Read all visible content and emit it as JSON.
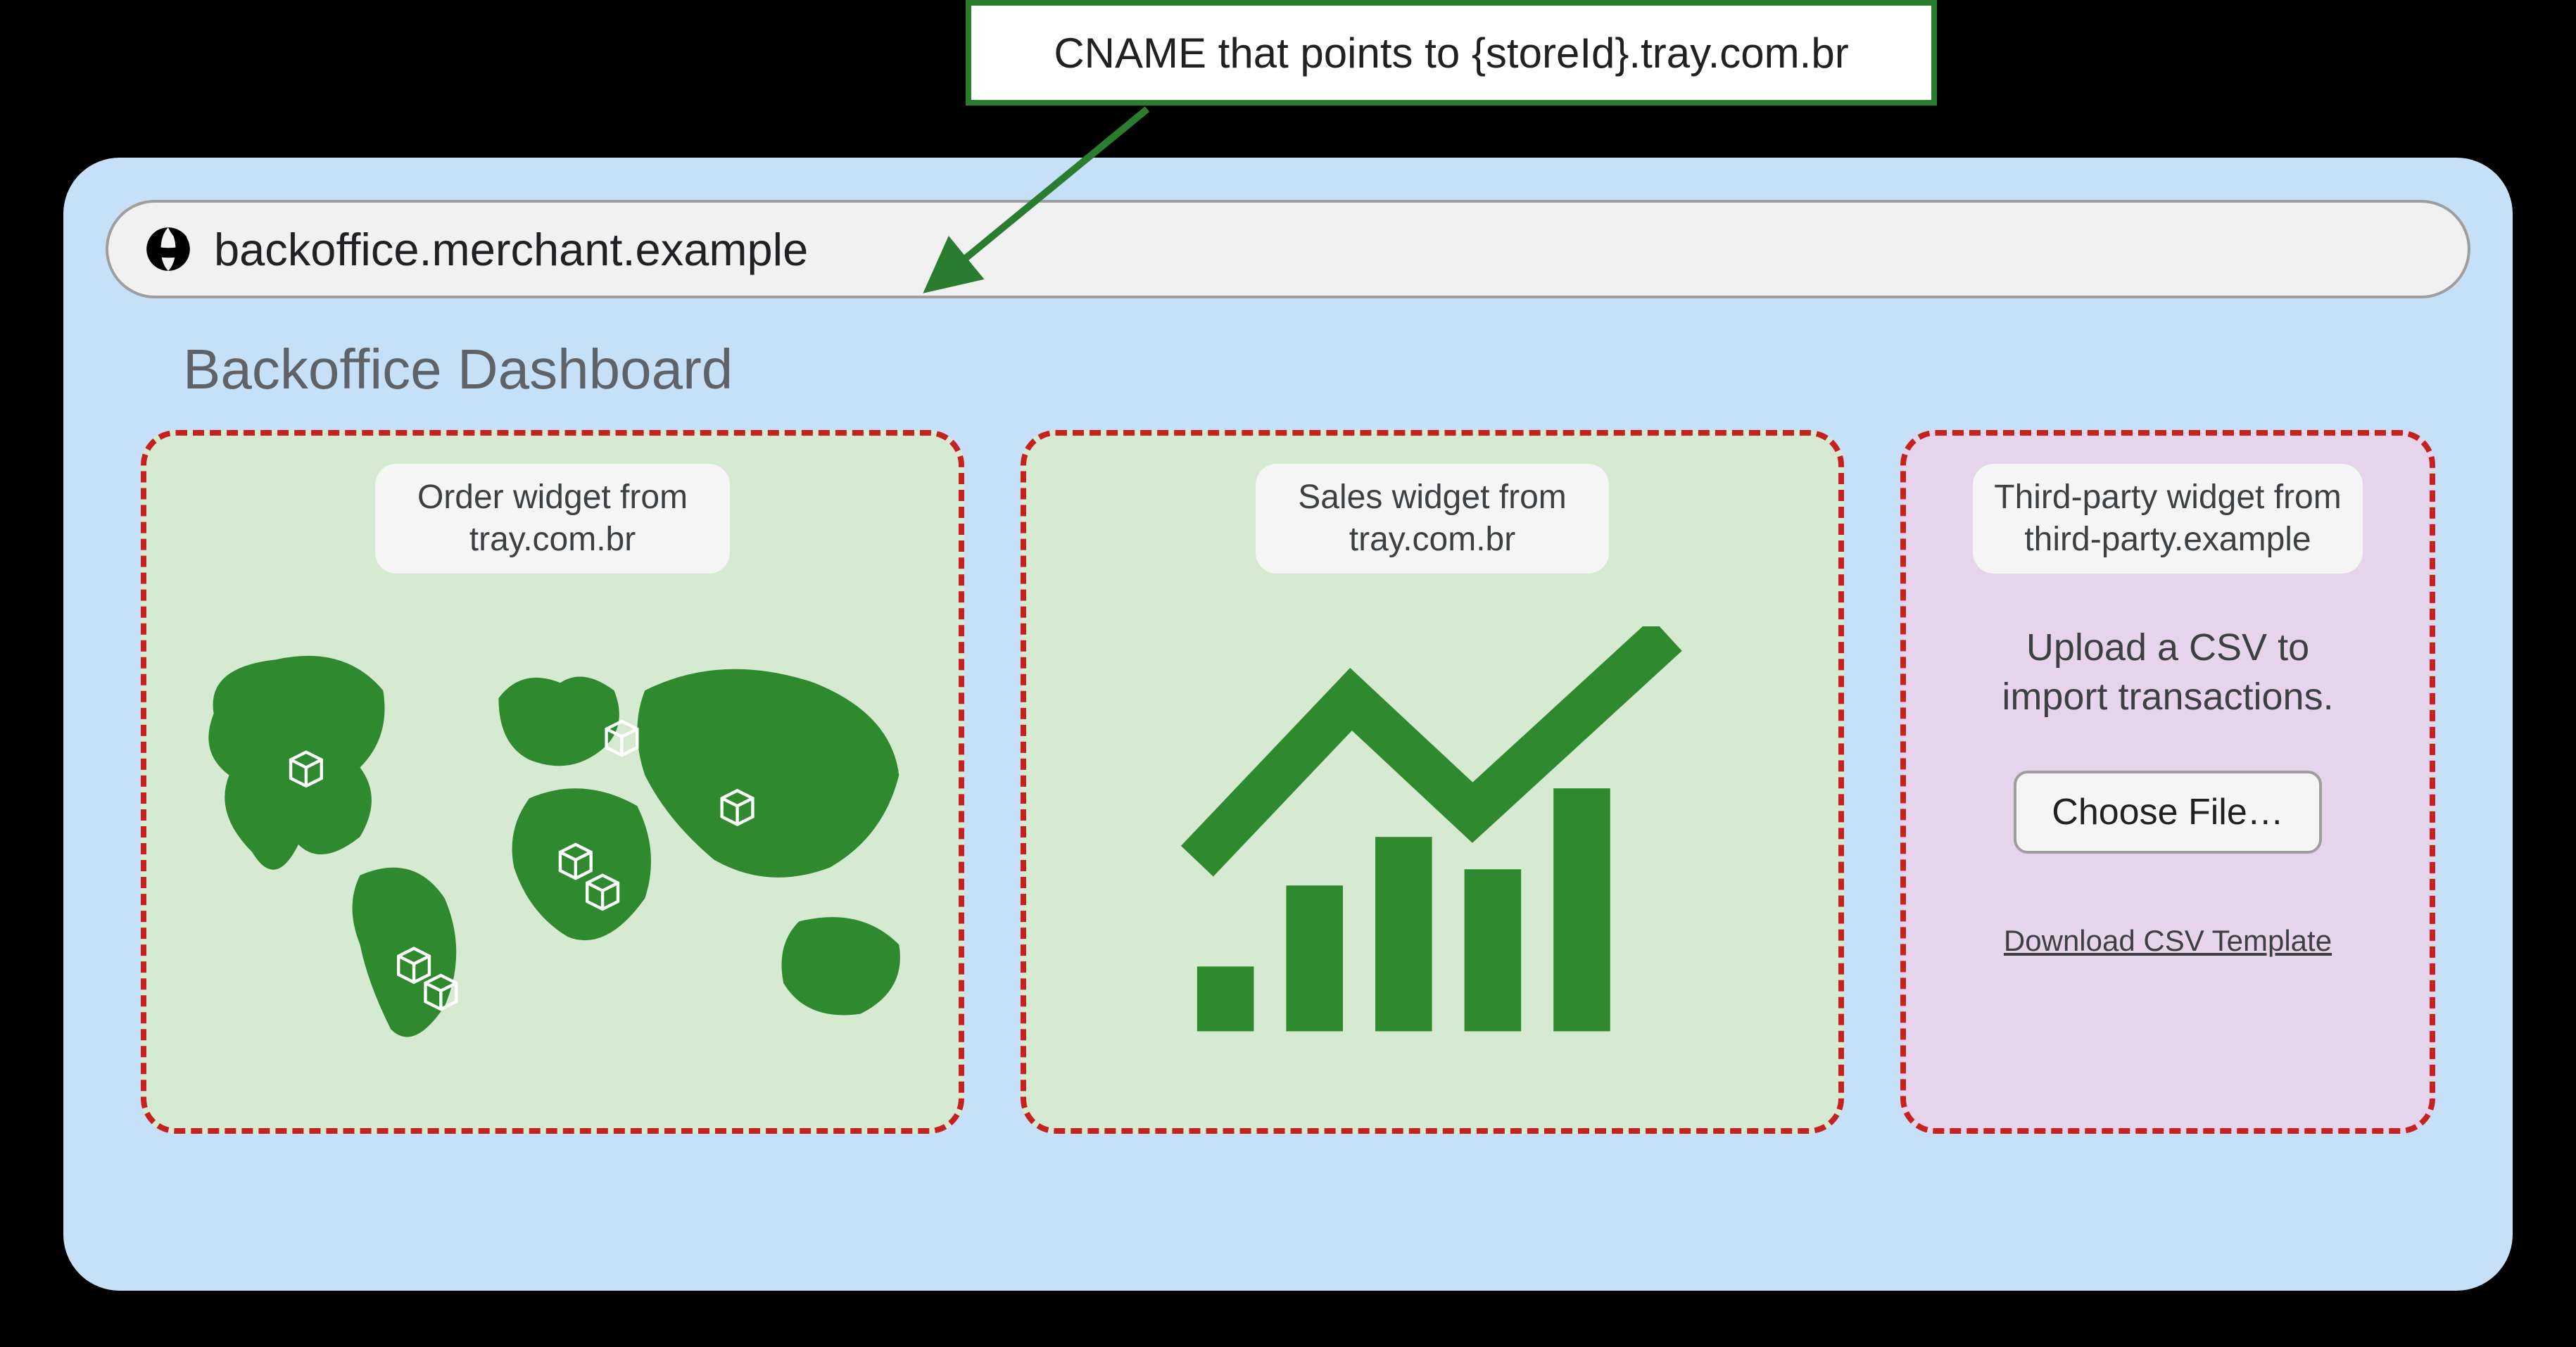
{
  "callout": {
    "text": "CNAME that points to {storeId}.tray.com.br"
  },
  "browser": {
    "url": "backoffice.merchant.example",
    "title": "Backoffice Dashboard"
  },
  "widgets": {
    "order": {
      "label": "Order widget from\ntray.com.br"
    },
    "sales": {
      "label": "Sales widget from\ntray.com.br"
    },
    "third": {
      "label": "Third-party widget from\nthird-party.example",
      "upload_text": "Upload a CSV to\nimport transactions.",
      "choose_label": "Choose File…",
      "download_label": "Download CSV Template"
    }
  }
}
